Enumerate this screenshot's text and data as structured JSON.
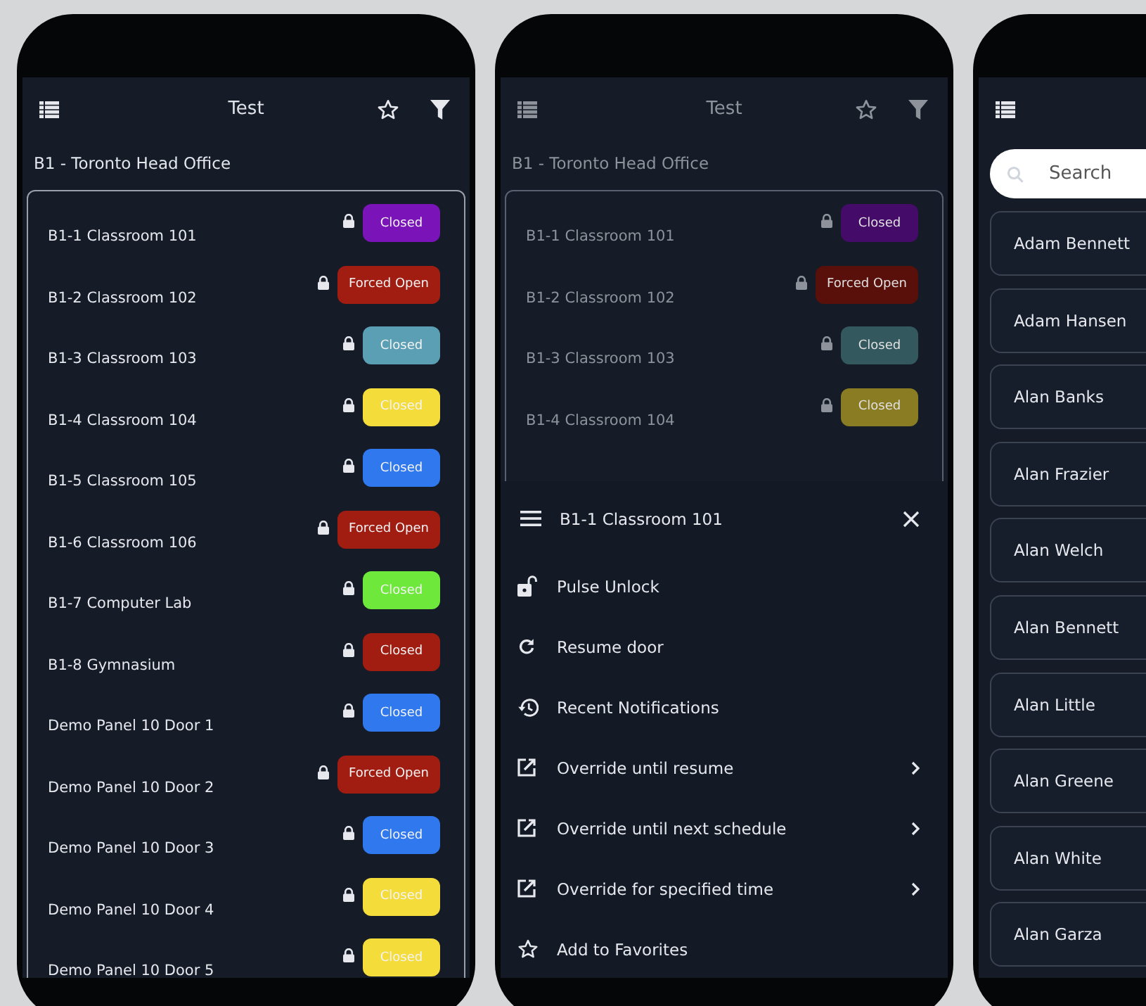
{
  "screens": [
    {
      "kind": "doors",
      "dimmed": false,
      "header": {
        "title": "Test"
      },
      "site": "B1 - Toronto Head Office",
      "doors": [
        {
          "name": "B1-1 Classroom 101",
          "status": "Closed",
          "color": "#7a14b8"
        },
        {
          "name": "B1-2 Classroom 102",
          "status": "Forced Open",
          "color": "#a11d12"
        },
        {
          "name": "B1-3 Classroom 103",
          "status": "Closed",
          "color": "#5a9fb4"
        },
        {
          "name": "B1-4 Classroom 104",
          "status": "Closed",
          "color": "#f4dc3a"
        },
        {
          "name": "B1-5 Classroom 105",
          "status": "Closed",
          "color": "#2f78ee"
        },
        {
          "name": "B1-6 Classroom 106",
          "status": "Forced Open",
          "color": "#a11d12"
        },
        {
          "name": "B1-7 Computer Lab",
          "status": "Closed",
          "color": "#6ee83a"
        },
        {
          "name": "B1-8 Gymnasium",
          "status": "Closed",
          "color": "#a11d12"
        },
        {
          "name": "Demo Panel 10 Door 1",
          "status": "Closed",
          "color": "#2f78ee"
        },
        {
          "name": "Demo Panel 10 Door 2",
          "status": "Forced Open",
          "color": "#a11d12"
        },
        {
          "name": "Demo Panel 10 Door 3",
          "status": "Closed",
          "color": "#2f78ee"
        },
        {
          "name": "Demo Panel 10 Door 4",
          "status": "Closed",
          "color": "#f4dc3a"
        },
        {
          "name": "Demo Panel 10 Door 5",
          "status": "Closed",
          "color": "#f4dc3a"
        }
      ]
    },
    {
      "kind": "doors",
      "dimmed": true,
      "header": {
        "title": "Test"
      },
      "site": "B1 - Toronto Head Office",
      "doors": [
        {
          "name": "B1-1 Classroom 101",
          "status": "Closed",
          "color": "#440b68"
        },
        {
          "name": "B1-2 Classroom 102",
          "status": "Forced Open",
          "color": "#5a100a"
        },
        {
          "name": "B1-3 Classroom 103",
          "status": "Closed",
          "color": "#33595f"
        },
        {
          "name": "B1-4 Classroom 104",
          "status": "Closed",
          "color": "#8a7c22"
        }
      ],
      "sheet": {
        "title": "B1-1 Classroom 101",
        "actions": [
          {
            "kind": "unlock",
            "label": "Pulse Unlock",
            "submenu": false
          },
          {
            "kind": "resume",
            "label": "Resume door",
            "submenu": false
          },
          {
            "kind": "history",
            "label": "Recent Notifications",
            "submenu": false
          },
          {
            "kind": "override",
            "label": "Override until resume",
            "submenu": true
          },
          {
            "kind": "override",
            "label": "Override until next schedule",
            "submenu": true
          },
          {
            "kind": "override",
            "label": "Override for specified time",
            "submenu": true
          },
          {
            "kind": "favorite",
            "label": "Add to Favorites",
            "submenu": false
          }
        ]
      }
    },
    {
      "kind": "people",
      "search": {
        "placeholder": "Search"
      },
      "people": [
        "Adam Bennett",
        "Adam Hansen",
        "Alan Banks",
        "Alan Frazier",
        "Alan Welch",
        "Alan Bennett",
        "Alan Little",
        "Alan Greene",
        "Alan White",
        "Alan Garza"
      ]
    }
  ]
}
